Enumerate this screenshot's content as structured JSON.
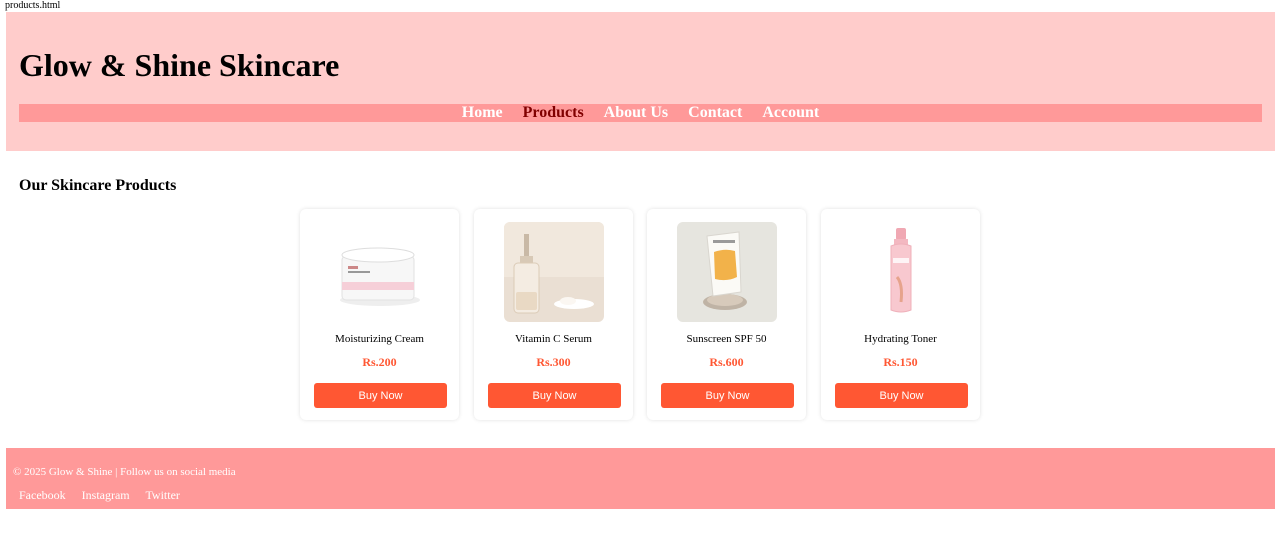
{
  "file_label": "products.html",
  "header": {
    "title": "Glow & Shine Skincare",
    "nav": [
      {
        "label": "Home",
        "active": false
      },
      {
        "label": "Products",
        "active": true
      },
      {
        "label": "About Us",
        "active": false
      },
      {
        "label": "Contact",
        "active": false
      },
      {
        "label": "Account",
        "active": false
      }
    ]
  },
  "main": {
    "section_title": "Our Skincare Products",
    "products": [
      {
        "name": "Moisturizing Cream",
        "price": "Rs.200",
        "button": "Buy Now",
        "image": "cream-jar-image"
      },
      {
        "name": "Vitamin C Serum",
        "price": "Rs.300",
        "button": "Buy Now",
        "image": "serum-bottle-image"
      },
      {
        "name": "Sunscreen SPF 50",
        "price": "Rs.600",
        "button": "Buy Now",
        "image": "sunscreen-tube-image"
      },
      {
        "name": "Hydrating Toner",
        "price": "Rs.150",
        "button": "Buy Now",
        "image": "toner-bottle-image"
      }
    ]
  },
  "footer": {
    "copyright": "© 2025 Glow & Shine | Follow us on social media",
    "social": [
      "Facebook",
      "Instagram",
      "Twitter"
    ]
  },
  "colors": {
    "header_bg": "#ffcccb",
    "nav_bg": "#ff9999",
    "nav_active": "#800000",
    "accent": "#ff5733",
    "footer_bg": "#ff9999"
  }
}
